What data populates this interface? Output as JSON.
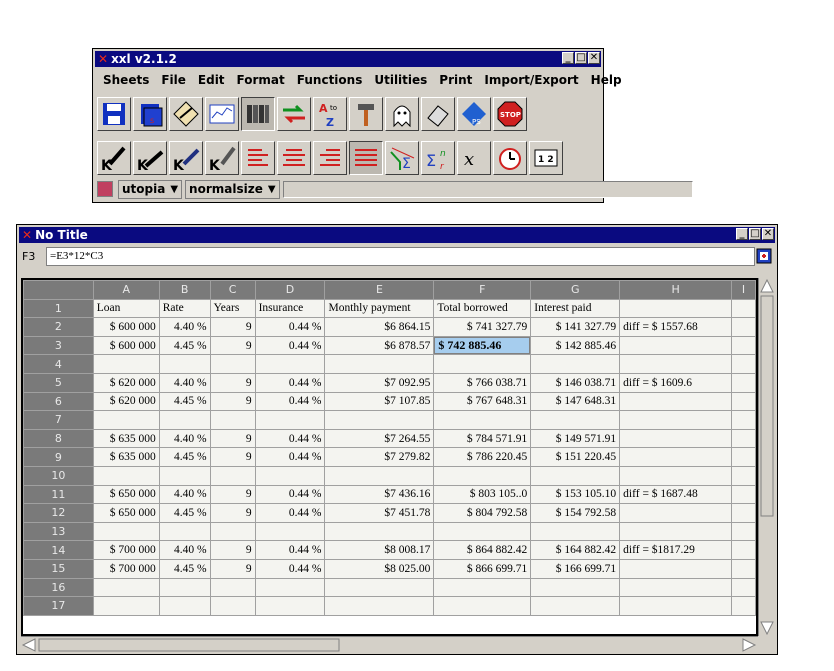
{
  "toolbar_window": {
    "title": "xxl v2.1.2",
    "menu": [
      "Sheets",
      "File",
      "Edit",
      "Format",
      "Functions",
      "Utilities",
      "Print",
      "Import/Export",
      "Help"
    ],
    "font_name": "utopia",
    "font_size": "normalsize",
    "icons_row1": [
      "save-icon",
      "save-sheets-icon",
      "edit-cell-icon",
      "chart-icon",
      "books-icon",
      "swap-arrows-icon",
      "sort-az-icon",
      "hammer-icon",
      "ghost-icon",
      "eraser-icon",
      "export-ps-icon",
      "stop-icon"
    ],
    "icons_row2": [
      "pen-k1-icon",
      "pen-k2-icon",
      "pen-k3-icon",
      "pen-k4-icon",
      "align-left-icon",
      "align-center-icon",
      "align-right-icon",
      "align-justify-icon",
      "sum-filter-icon",
      "sum-n-r-icon",
      "function-x-icon",
      "alarm-clock-icon",
      "numbers-icon"
    ],
    "colors": {
      "titlebar": "#0a0a80",
      "stop": "#d02020"
    }
  },
  "sheet_window": {
    "title": "No Title",
    "cell_ref": "F3",
    "formula": "=E3*12*C3",
    "columns": [
      "A",
      "B",
      "C",
      "D",
      "E",
      "F",
      "G",
      "H",
      "I"
    ],
    "rows": [
      [
        "1",
        "Loan",
        "Rate",
        "Years",
        "Insurance",
        "Monthly payment",
        "Total borrowed",
        "Interest paid",
        "",
        ""
      ],
      [
        "2",
        "$ 600 000",
        "4.40 %",
        "9",
        "0.44 %",
        "$6 864.15",
        "$ 741 327.79",
        "$ 141 327.79",
        "diff = $ 1557.68",
        ""
      ],
      [
        "3",
        "$ 600 000",
        "4.45 %",
        "9",
        "0.44 %",
        "$6 878.57",
        "$ 742 885.46",
        "$ 142 885.46",
        "",
        ""
      ],
      [
        "4",
        "",
        "",
        "",
        "",
        "",
        "",
        "",
        "",
        ""
      ],
      [
        "5",
        "$ 620 000",
        "4.40 %",
        "9",
        "0.44 %",
        "$7 092.95",
        "$ 766 038.71",
        "$ 146 038.71",
        "diff = $ 1609.6",
        ""
      ],
      [
        "6",
        "$ 620 000",
        "4.45 %",
        "9",
        "0.44 %",
        "$7 107.85",
        "$ 767 648.31",
        "$ 147 648.31",
        "",
        ""
      ],
      [
        "7",
        "",
        "",
        "",
        "",
        "",
        "",
        "",
        "",
        ""
      ],
      [
        "8",
        "$ 635 000",
        "4.40 %",
        "9",
        "0.44 %",
        "$7 264.55",
        "$ 784 571.91",
        "$ 149 571.91",
        "",
        ""
      ],
      [
        "9",
        "$ 635 000",
        "4.45 %",
        "9",
        "0.44 %",
        "$7 279.82",
        "$ 786 220.45",
        "$ 151 220.45",
        "",
        ""
      ],
      [
        "10",
        "",
        "",
        "",
        "",
        "",
        "",
        "",
        "",
        ""
      ],
      [
        "11",
        "$ 650 000",
        "4.40 %",
        "9",
        "0.44 %",
        "$7 436.16",
        "$ 803 105..0",
        "$ 153 105.10",
        "diff = $ 1687.48",
        ""
      ],
      [
        "12",
        "$ 650 000",
        "4.45 %",
        "9",
        "0.44 %",
        "$7 451.78",
        "$ 804 792.58",
        "$ 154 792.58",
        "",
        ""
      ],
      [
        "13",
        "",
        "",
        "",
        "",
        "",
        "",
        "",
        "",
        ""
      ],
      [
        "14",
        "$ 700 000",
        "4.40 %",
        "9",
        "0.44 %",
        "$8 008.17",
        "$ 864 882.42",
        "$ 164 882.42",
        "diff = $1817.29",
        ""
      ],
      [
        "15",
        "$ 700 000",
        "4.45 %",
        "9",
        "0.44 %",
        "$8 025.00",
        "$ 866 699.71",
        "$ 166 699.71",
        "",
        ""
      ],
      [
        "16",
        "",
        "",
        "",
        "",
        "",
        "",
        "",
        "",
        ""
      ],
      [
        "17",
        "",
        "",
        "",
        "",
        "",
        "",
        "",
        "",
        ""
      ]
    ],
    "selected_cell": "F3",
    "colors": {
      "selected": "#a6cdee",
      "header": "#7a7a7a"
    }
  }
}
